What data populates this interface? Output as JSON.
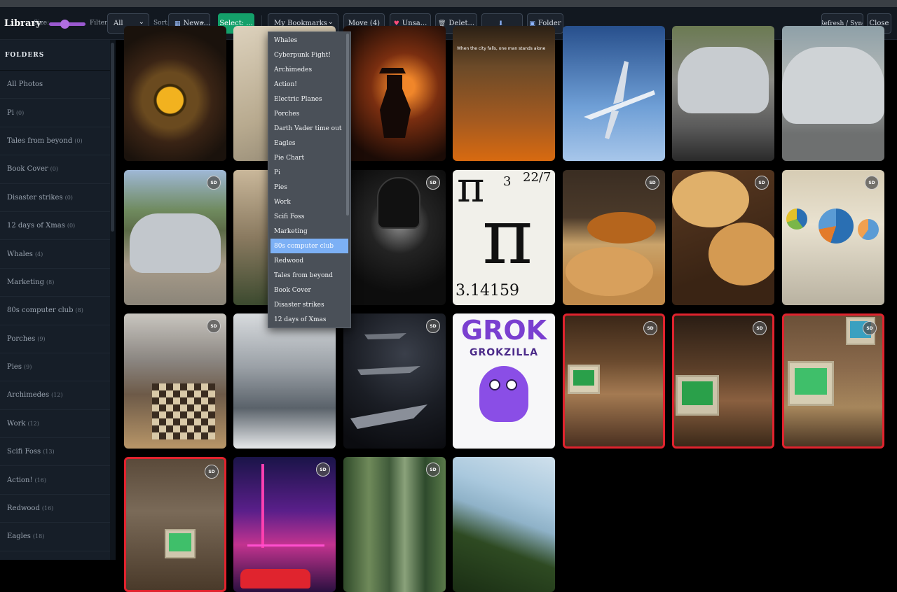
{
  "toolbar": {
    "title": "Library",
    "size_label": "Size:",
    "filter_label": "Filter:",
    "filter_value": "All",
    "sort_label": "Sort:",
    "sort_value": "Newe...",
    "select_label": "Select: ...",
    "bookmarks_value": "My Bookmarks",
    "move_label": "Move (4)",
    "unsave_label": "Unsa...",
    "delete_label": "Delet...",
    "folder_label": "Folder",
    "refresh_label": "Refresh / Sync",
    "close_label": "Close",
    "size_level": 0.3
  },
  "sidebar": {
    "header": "FOLDERS",
    "items": [
      {
        "label": "All Photos",
        "count": ""
      },
      {
        "label": "Pi",
        "count": "(0)"
      },
      {
        "label": "Tales from beyond",
        "count": "(0)"
      },
      {
        "label": "Book Cover",
        "count": "(0)"
      },
      {
        "label": "Disaster strikes",
        "count": "(0)"
      },
      {
        "label": "12 days of Xmas",
        "count": "(0)"
      },
      {
        "label": "Whales",
        "count": "(4)"
      },
      {
        "label": "Marketing",
        "count": "(8)"
      },
      {
        "label": "80s computer club",
        "count": "(8)"
      },
      {
        "label": "Porches",
        "count": "(9)"
      },
      {
        "label": "Pies",
        "count": "(9)"
      },
      {
        "label": "Archimedes",
        "count": "(12)"
      },
      {
        "label": "Work",
        "count": "(12)"
      },
      {
        "label": "Scifi Foss",
        "count": "(13)"
      },
      {
        "label": "Action!",
        "count": "(16)"
      },
      {
        "label": "Redwood",
        "count": "(16)"
      },
      {
        "label": "Eagles",
        "count": "(18)"
      }
    ]
  },
  "dropdown": {
    "highlighted": "80s computer club",
    "items": [
      "Whales",
      "Cyberpunk Fight!",
      "Archimedes",
      "Action!",
      "Electric Planes",
      "Porches",
      "Darth Vader time out",
      "Eagles",
      "Pie Chart",
      "Pi",
      "Pies",
      "Work",
      "Scifi Foss",
      "Marketing",
      "80s computer club",
      "Redwood",
      "Tales from beyond",
      "Book Cover",
      "Disaster strikes",
      "12 days of Xmas"
    ]
  },
  "images": {
    "badge": "SD",
    "poster_tagline": "When the city falls, one man stands alone",
    "grok_title": "GROK",
    "grok_subtitle": "GROKZILLA",
    "pi_sym_big": "π",
    "pi_frac": "22/7",
    "pi_small": "3",
    "pi_value": "3.14159"
  },
  "colors": {
    "accent_purple": "#9b59d0",
    "select_green": "#14a06a",
    "selected_border": "#e0232e",
    "dropdown_highlight": "#7cb0f5"
  }
}
